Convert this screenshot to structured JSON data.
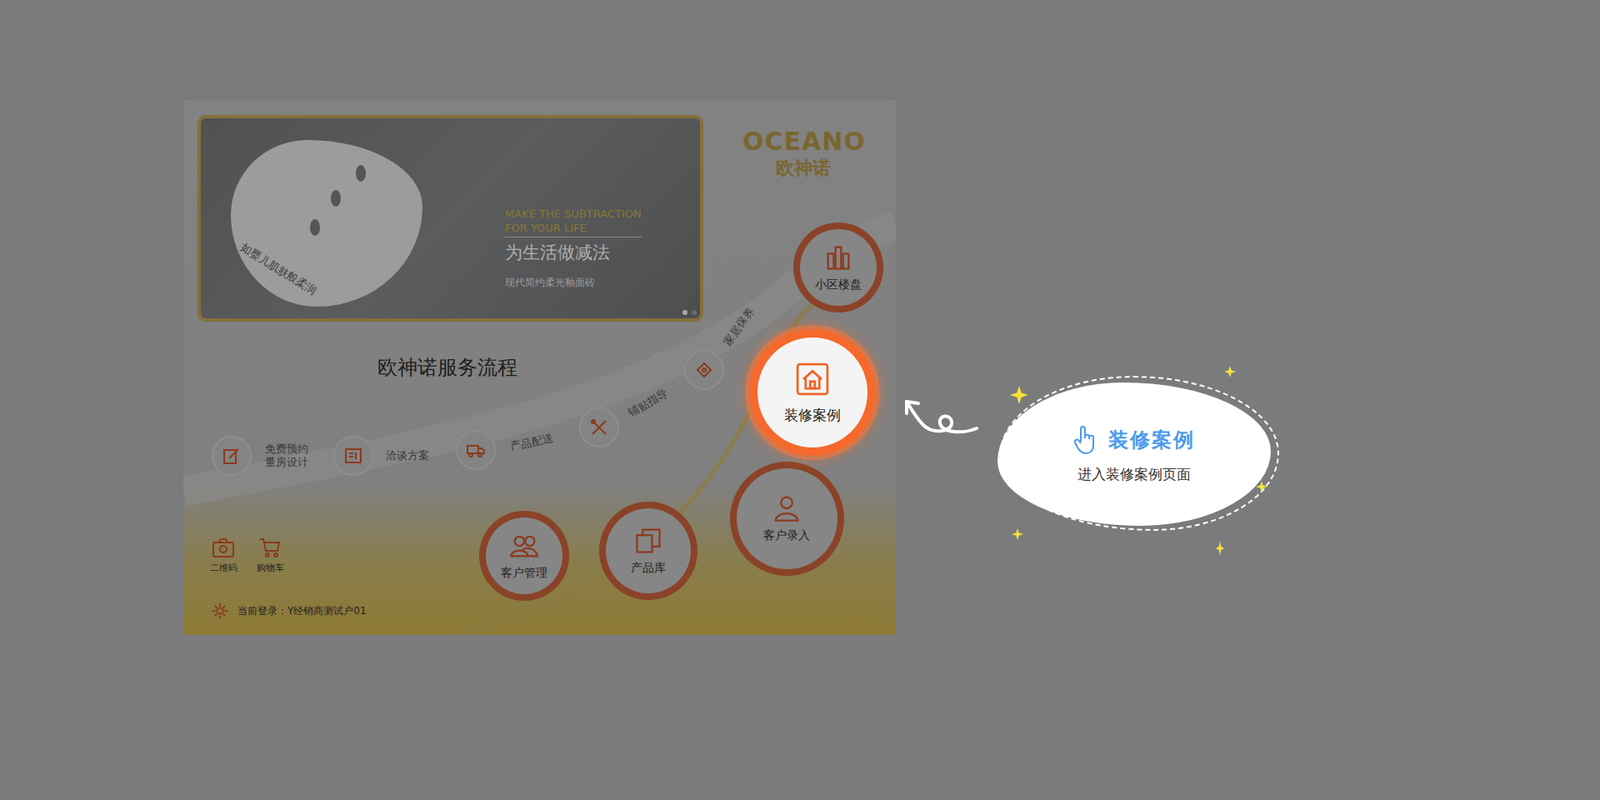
{
  "logo": {
    "brand": "OCEANO",
    "name": "欧神诺"
  },
  "banner": {
    "headline": [
      "MAKE THE SUBTRACTION",
      "FOR YOUR LIFE"
    ],
    "title": "为生活做减法",
    "subtitle": "现代简约柔光釉面砖",
    "badge": "如婴儿肌肤般柔润",
    "dots": [
      {
        "selected": true
      },
      {
        "selected": false
      }
    ]
  },
  "service": {
    "title": "欧神诺服务流程",
    "steps": [
      {
        "label": [
          "免费预约",
          "量房设计"
        ]
      },
      {
        "label": [
          "洽谈方案"
        ]
      },
      {
        "label": [
          "产品配送"
        ]
      },
      {
        "label": [
          "铺贴指导"
        ]
      },
      {
        "label": [
          "家居保养"
        ]
      }
    ]
  },
  "menu": [
    {
      "label": "小区楼盘",
      "selected": false
    },
    {
      "label": "装修案例",
      "selected": true
    },
    {
      "label": "客户录入",
      "selected": false
    },
    {
      "label": "产品库",
      "selected": false
    },
    {
      "label": "客户管理",
      "selected": false
    }
  ],
  "tools": [
    {
      "label": "二维码"
    },
    {
      "label": "购物车"
    }
  ],
  "status": {
    "login": "当前登录：Y经销商测试户01"
  },
  "callout": {
    "title": "装修案例",
    "text": "进入装修案例页面"
  }
}
